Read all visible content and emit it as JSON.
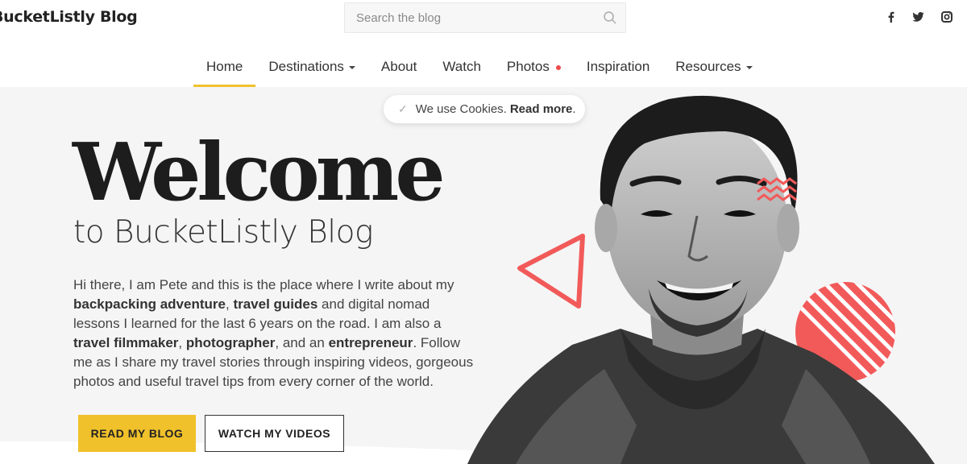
{
  "header": {
    "logo": "BucketListly Blog",
    "search_placeholder": "Search the blog",
    "social": [
      "facebook-icon",
      "twitter-icon",
      "instagram-icon"
    ]
  },
  "nav": {
    "items": [
      {
        "label": "Home",
        "active": true
      },
      {
        "label": "Destinations",
        "dropdown": true
      },
      {
        "label": "About"
      },
      {
        "label": "Watch"
      },
      {
        "label": "Photos",
        "badge": true
      },
      {
        "label": "Inspiration"
      },
      {
        "label": "Resources",
        "dropdown": true
      }
    ]
  },
  "cookie": {
    "text": "We use Cookies.",
    "link": "Read more",
    "suffix": "."
  },
  "hero": {
    "title": "Welcome",
    "subtitle": "to BucketListly Blog",
    "intro": {
      "p1": "Hi there, I am Pete and this is the place where I write about my",
      "b1": "backpacking adventure",
      "p2": ",",
      "b2": "travel guides",
      "p3": "and digital nomad lessons I learned for the last 6 years on the road. I am also a",
      "b3": "travel filmmaker",
      "p4": ",",
      "b4": "photographer",
      "p5": ", and an",
      "b5": "entrepreneur",
      "p6": ". Follow me as I share my travel stories through inspiring videos, gorgeous photos and useful travel tips from every corner of the world."
    },
    "buttons": {
      "primary": "READ MY BLOG",
      "secondary": "WATCH MY VIDEOS"
    }
  },
  "colors": {
    "accent": "#f0c12b",
    "decor": "#f25a5a",
    "text": "#333333",
    "hero_bg": "#f5f5f5"
  }
}
